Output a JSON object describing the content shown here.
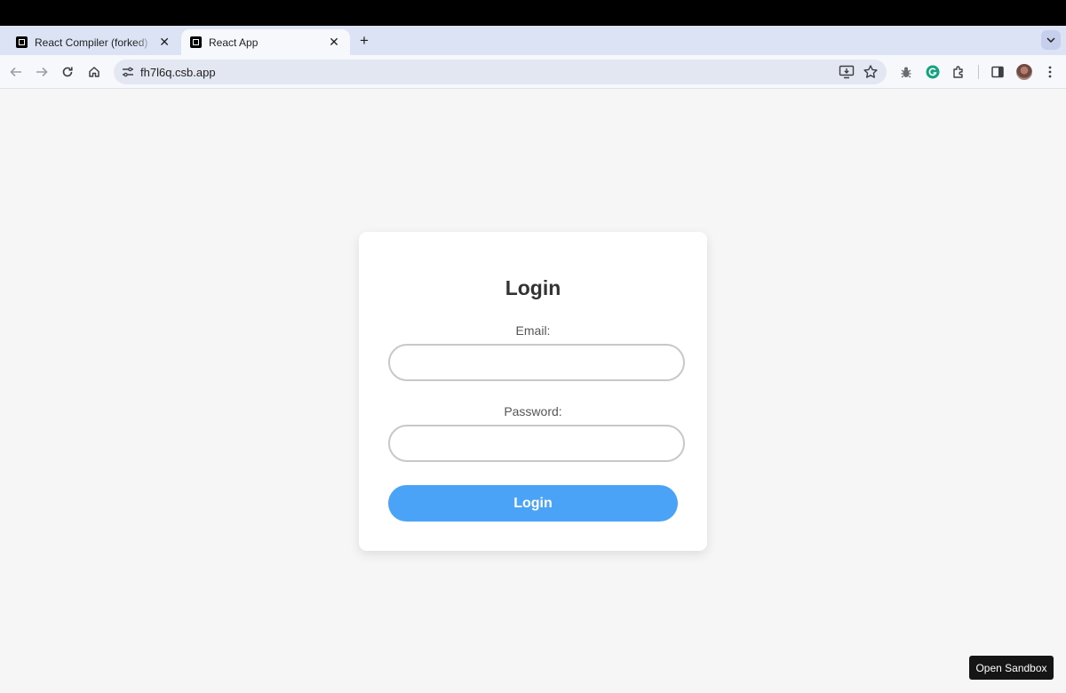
{
  "browser": {
    "tabs": [
      {
        "title": "React Compiler (forked) - Co",
        "active": false
      },
      {
        "title": "React App",
        "active": true
      }
    ],
    "address": "fh7l6q.csb.app"
  },
  "login": {
    "heading": "Login",
    "email_label": "Email:",
    "email_value": "",
    "password_label": "Password:",
    "password_value": "",
    "submit_label": "Login"
  },
  "sandbox": {
    "open_label": "Open Sandbox"
  },
  "colors": {
    "primary": "#4aa3f6",
    "tabstrip": "#dce3f5",
    "page_bg": "#f6f6f6"
  }
}
